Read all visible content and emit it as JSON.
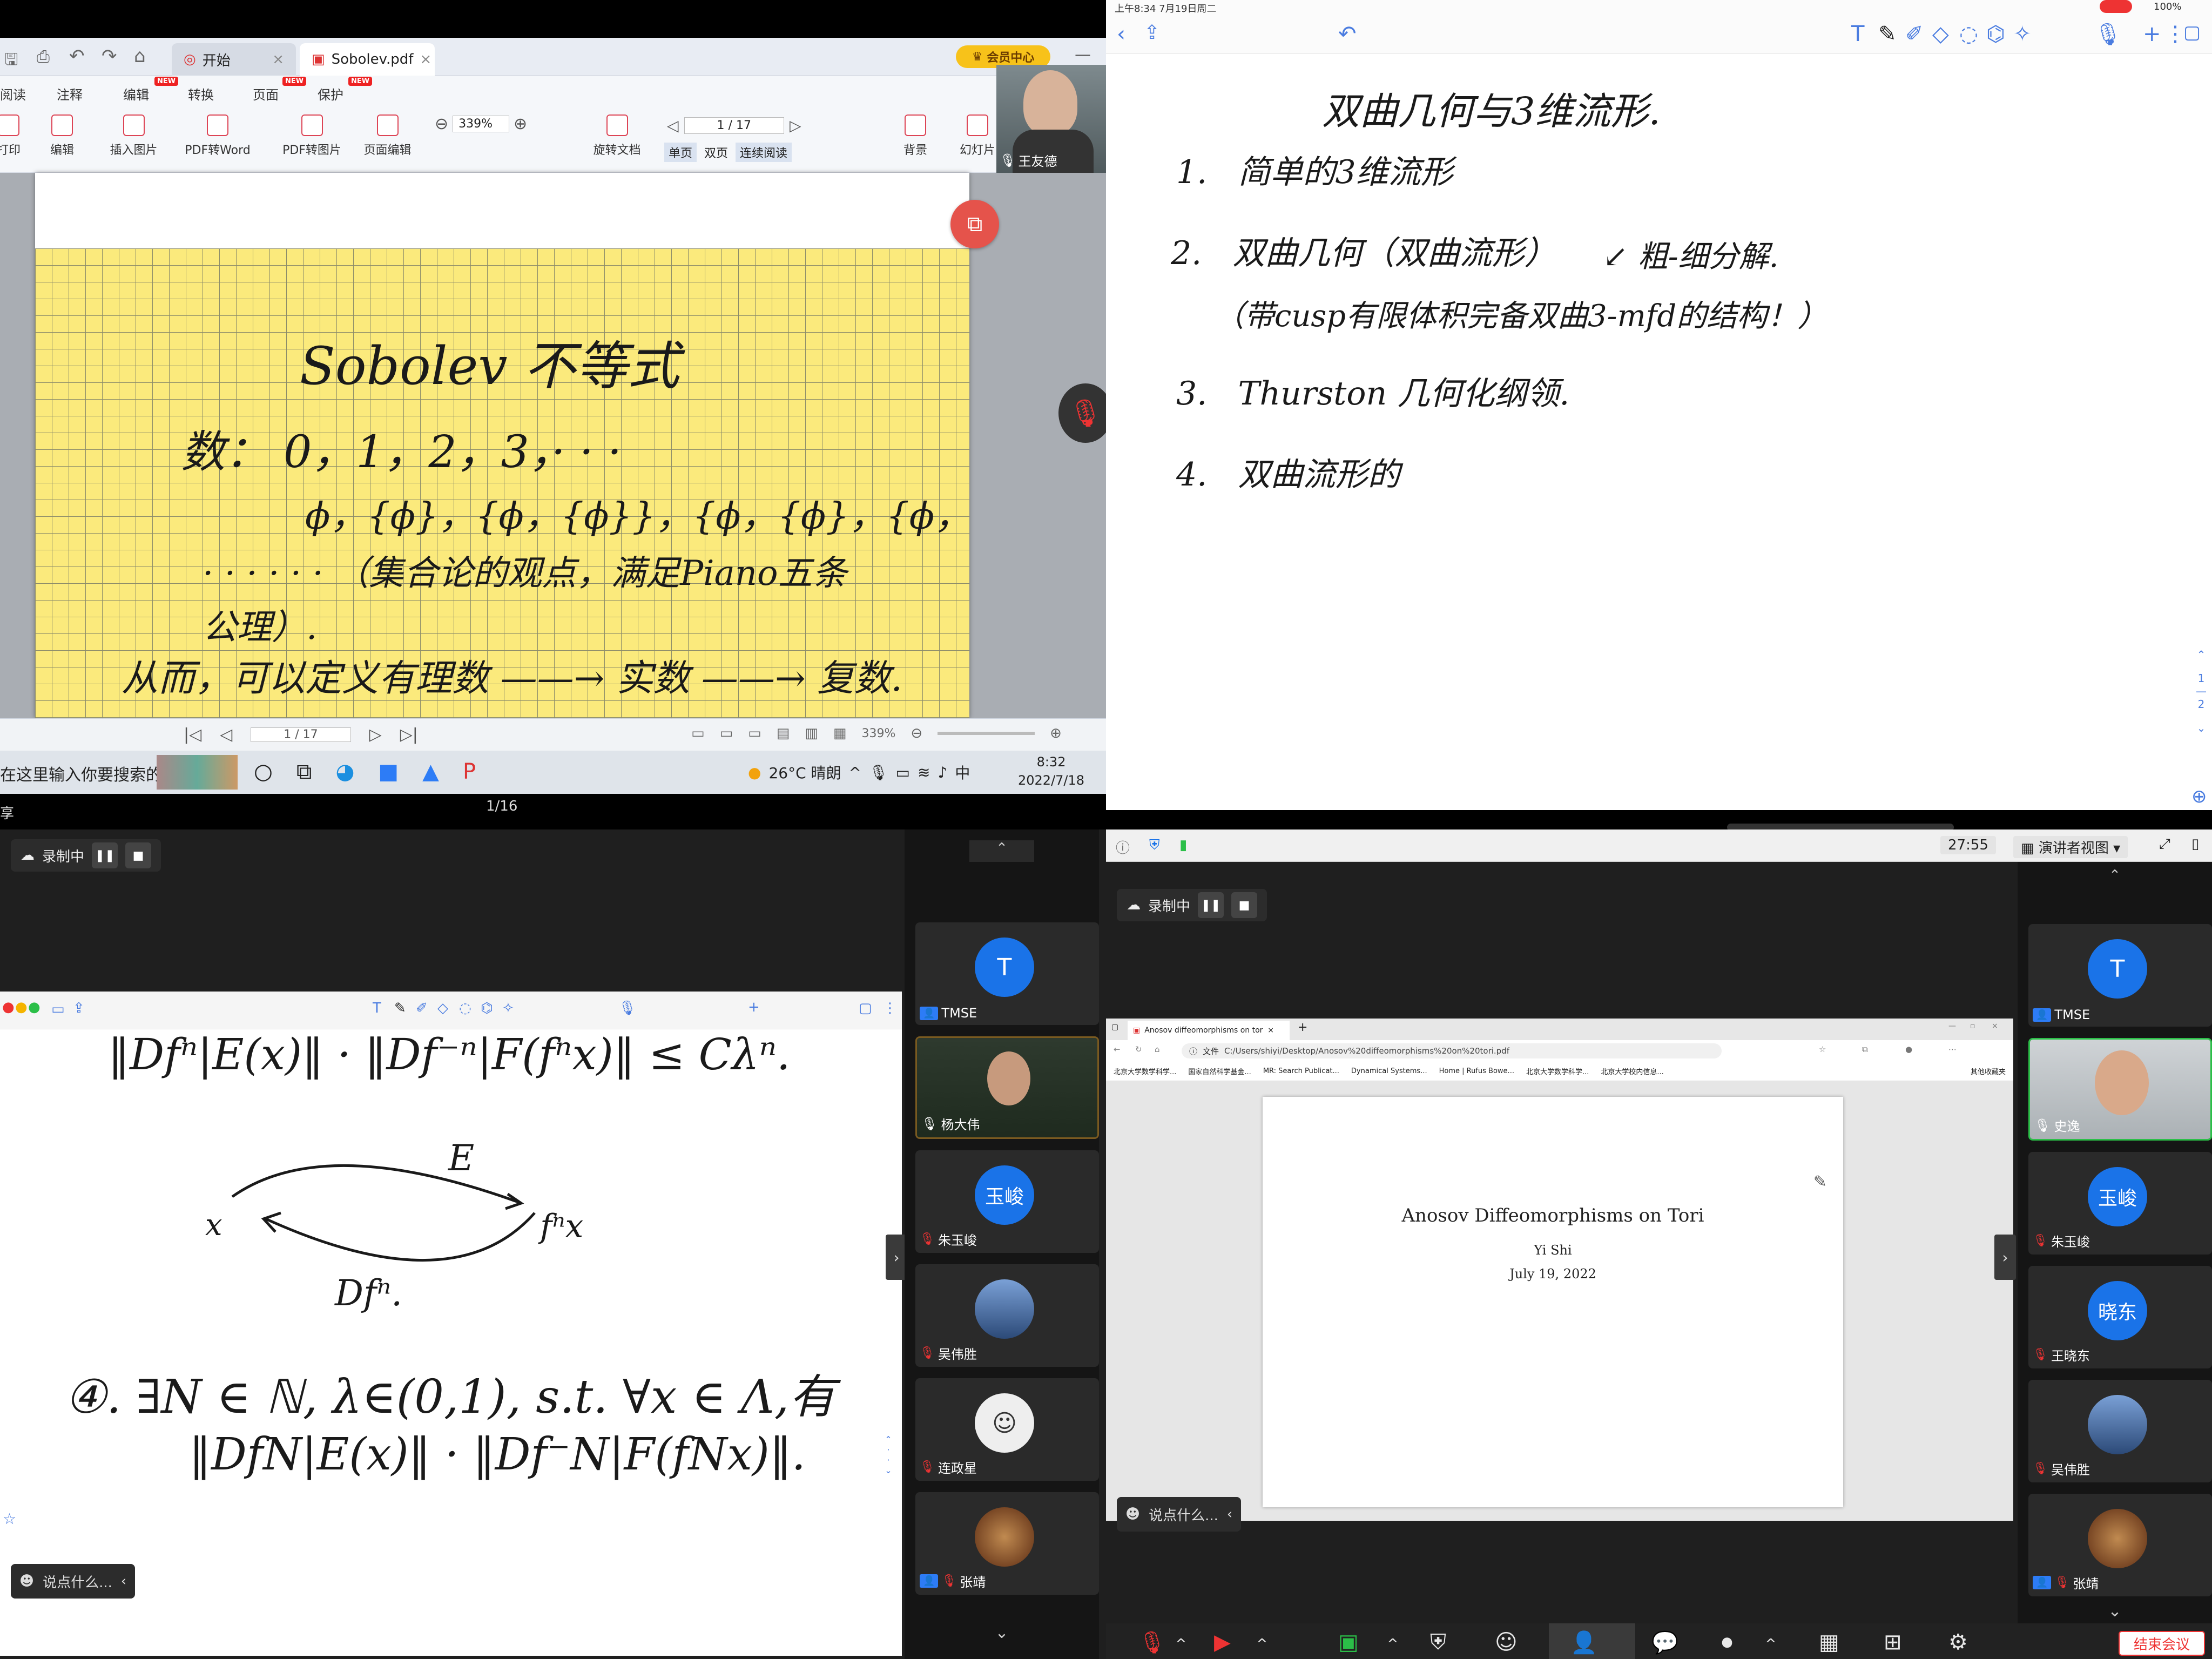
{
  "pdf_viewer": {
    "tabs": [
      {
        "label": "开始"
      },
      {
        "label": "Sobolev.pdf"
      }
    ],
    "member_center": "会员中心",
    "menu": [
      "阅读",
      "注释",
      "编辑",
      "转换",
      "页面",
      "保护"
    ],
    "new_badge": "NEW",
    "ribbon": [
      "打印",
      "编辑",
      "插入图片",
      "PDF转Word",
      "PDF转图片",
      "页面编辑",
      "旋转文档",
      "背景",
      "幻灯片"
    ],
    "zoom": "339%",
    "page_indicator": "1 / 17",
    "view_modes": [
      "单页",
      "双页",
      "连续阅读"
    ],
    "presenter_name": "王友德",
    "page_content": {
      "title": "Sobolev 不等式",
      "line1": "数： 0，1，2，3，· · ·",
      "line2": "ϕ，{ϕ}，{ϕ，{ϕ}}，{ϕ，{ϕ}，{ϕ，{ϕ}}}，",
      "line3": "· · · · · ·  （集合论的观点，满足Piano五条",
      "line4": "公理）.",
      "line5": "从而，可以定义有理数 ——→ 实数 ——→ 复数."
    },
    "status_page": "1 / 17",
    "status_zoom": "339%",
    "taskbar": {
      "search": "在这里输入你要搜索的内容",
      "weather": "26°C 晴朗",
      "ime": "中",
      "time": "8:32",
      "date": "2022/7/18"
    },
    "bottom_page": "1/16",
    "bottom_left": "享"
  },
  "notes_app": {
    "status_time": "上午8:34  7月19日周二",
    "battery": "100%",
    "side_pages": [
      "1",
      "2"
    ],
    "content": {
      "title": "双曲几何与3维流形.",
      "items": [
        {
          "num": "1.",
          "text": "简单的3维流形"
        },
        {
          "num": "2.",
          "text": "双曲几何（双曲流形）"
        },
        {
          "num": "",
          "text": "（带cusp有限体积完备双曲3-mfd的结构！）"
        },
        {
          "num": "3.",
          "text": "Thurston 几何化纲领."
        },
        {
          "num": "4.",
          "text": "双曲流形的"
        }
      ],
      "annotation": "粗-细分解."
    }
  },
  "meeting_left": {
    "recording": "录制中",
    "notes": {
      "line1": "‖Dfⁿ|E(x)‖ · ‖Df⁻ⁿ|F(fⁿx)‖ ≤ Cλⁿ.",
      "arrow_top": "E",
      "point_x": "x",
      "point_fx": "fⁿx",
      "arrow_bottom": "Dfⁿ.",
      "line2": "④. ∃N ∈ ℕ, λ∈(0,1), s.t. ∀x ∈ Λ,有",
      "line3": "‖DfN|E(x)‖ · ‖Df⁻N|F(fNx)‖."
    },
    "chat_placeholder": "说点什么...",
    "participants": [
      {
        "avatar": "T",
        "name": "TMSE",
        "host": "主持人",
        "color": "#1a73e8"
      },
      {
        "avatar": "",
        "name": "杨大伟",
        "host": "",
        "color": ""
      },
      {
        "avatar": "玉峻",
        "name": "朱玉峻",
        "host": "",
        "color": "#1a73e8"
      },
      {
        "avatar": "",
        "name": "吴伟胜",
        "host": "",
        "color": ""
      },
      {
        "avatar": "",
        "name": "连政星",
        "host": "",
        "color": ""
      },
      {
        "avatar": "",
        "name": "张靖",
        "host": "主持人",
        "color": ""
      }
    ]
  },
  "meeting_right": {
    "timer": "27:55",
    "view_mode": "演讲者视图",
    "recording": "录制中",
    "chat_placeholder": "说点什么...",
    "browser": {
      "tab_title": "Anosov diffeomorphisms on tori",
      "address": "C:/Users/shiyi/Desktop/Anosov%20diffeomorphisms%20on%20tori.pdf",
      "address_label": "文件",
      "bookmarks": [
        "北京大学数学科学...",
        "国家自然科学基金...",
        "MR: Search Publicat...",
        "Dynamical Systems...",
        "Home | Rufus Bowe...",
        "北京大学数学科学...",
        "北京大学校内信息..."
      ],
      "bookmarks_folder": "其他收藏夹"
    },
    "paper": {
      "title": "Anosov Diffeomorphisms on Tori",
      "author": "Yi Shi",
      "date": "July 19, 2022"
    },
    "participants": [
      {
        "avatar": "T",
        "name": "TMSE",
        "color": "#1a73e8"
      },
      {
        "avatar": "",
        "name": "史逸",
        "color": ""
      },
      {
        "avatar": "玉峻",
        "name": "朱玉峻",
        "color": "#1a73e8"
      },
      {
        "avatar": "晓东",
        "name": "王晓东",
        "color": "#1a73e8"
      },
      {
        "avatar": "",
        "name": "吴伟胜",
        "color": ""
      },
      {
        "avatar": "",
        "name": "张靖",
        "color": ""
      }
    ],
    "end_meeting": "结束会议"
  }
}
